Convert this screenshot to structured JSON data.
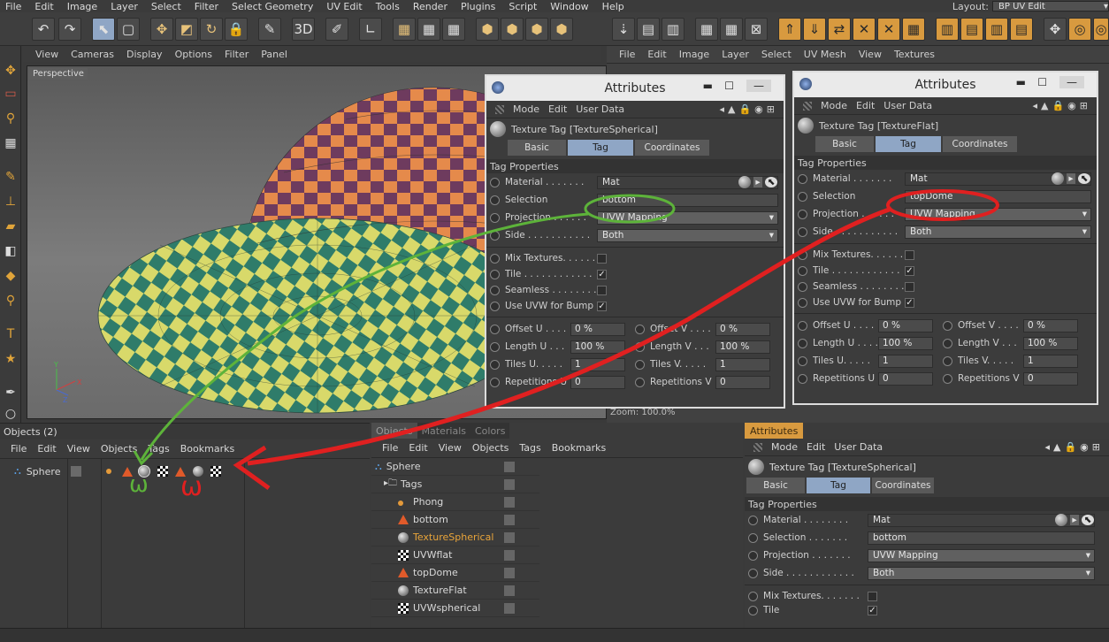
{
  "menubar": {
    "items": [
      "File",
      "Edit",
      "Image",
      "Layer",
      "Select",
      "Filter",
      "Select Geometry",
      "UV Edit",
      "Tools",
      "Render",
      "Plugins",
      "Script",
      "Window",
      "Help"
    ],
    "layout_label": "Layout:",
    "layout_value": "BP UV Edit"
  },
  "viewport": {
    "menu": [
      "View",
      "Cameras",
      "Display",
      "Options",
      "Filter",
      "Panel"
    ],
    "label": "Perspective"
  },
  "uv": {
    "menu": [
      "File",
      "Edit",
      "Image",
      "Layer",
      "Select",
      "UV Mesh",
      "View",
      "Textures"
    ],
    "zoom": "Zoom: 100.0%"
  },
  "attr_left": {
    "title": "Attributes",
    "menu": [
      "Mode",
      "Edit",
      "User Data"
    ],
    "tag_title": "Texture Tag [TextureSpherical]",
    "tabs": [
      "Basic",
      "Tag",
      "Coordinates"
    ],
    "active_tab": "Tag",
    "section": "Tag Properties",
    "material_label": "Material . . . . . . .",
    "material": "Mat",
    "selection_label": "Selection",
    "selection": "bottom",
    "projection_label": "Projection . . . . . .",
    "projection": "UVW Mapping",
    "side_label": "Side . . . . . . . . . . .",
    "side": "Both",
    "mix_label": "Mix Textures. . . . . .",
    "tile_label": "Tile . . . . . . . . . . . .",
    "seamless_label": "Seamless . . . . . . . .",
    "uvwbump_label": "Use UVW for Bump",
    "offset_u_label": "Offset U . . . .",
    "offset_u": "0 %",
    "offset_v_label": "Offset V . . . .",
    "offset_v": "0 %",
    "length_u_label": "Length U . . .",
    "length_u": "100 %",
    "length_v_label": "Length V . . .",
    "length_v": "100 %",
    "tiles_u_label": "Tiles U. . . . .",
    "tiles_u": "1",
    "tiles_v_label": "Tiles V. . . . .",
    "tiles_v": "1",
    "rep_u_label": "Repetitions U",
    "rep_u": "0",
    "rep_v_label": "Repetitions V",
    "rep_v": "0"
  },
  "attr_right": {
    "title": "Attributes",
    "menu": [
      "Mode",
      "Edit",
      "User Data"
    ],
    "tag_title": "Texture Tag [TextureFlat]",
    "tabs": [
      "Basic",
      "Tag",
      "Coordinates"
    ],
    "active_tab": "Tag",
    "section": "Tag Properties",
    "material_label": "Material . . . . . . .",
    "material": "Mat",
    "selection_label": "Selection",
    "selection": "topDome",
    "projection_label": "Projection . . . . . .",
    "projection": "UVW Mapping",
    "side_label": "Side . . . . . . . . . . .",
    "side": "Both",
    "mix_label": "Mix Textures. . . . . .",
    "tile_label": "Tile . . . . . . . . . . . .",
    "seamless_label": "Seamless . . . . . . . .",
    "uvwbump_label": "Use UVW for Bump",
    "offset_u_label": "Offset U . . . .",
    "offset_u": "0 %",
    "offset_v_label": "Offset V . . . .",
    "offset_v": "0 %",
    "length_u_label": "Length U . . . .",
    "length_u": "100 %",
    "length_v_label": "Length V . . .",
    "length_v": "100 %",
    "tiles_u_label": "Tiles U. . . . .",
    "tiles_u": "1",
    "tiles_v_label": "Tiles V. . . . .",
    "tiles_v": "1",
    "rep_u_label": "Repetitions U",
    "rep_u": "0",
    "rep_v_label": "Repetitions V",
    "rep_v": "0"
  },
  "objects": {
    "title": "Objects (2)",
    "menu": [
      "File",
      "Edit",
      "View",
      "Objects",
      "Tags",
      "Bookmarks"
    ],
    "sphere": "Sphere"
  },
  "objmgr": {
    "tabs": [
      "Objects",
      "Materials",
      "Colors"
    ],
    "menu": [
      "File",
      "Edit",
      "View",
      "Objects",
      "Tags",
      "Bookmarks"
    ],
    "rows": [
      "Sphere",
      "Tags",
      "Phong",
      "bottom",
      "TextureSpherical",
      "UVWflat",
      "topDome",
      "TextureFlat",
      "UVWspherical"
    ]
  },
  "attr_bottom": {
    "tab": "Attributes",
    "menu": [
      "Mode",
      "Edit",
      "User Data"
    ],
    "tag_title": "Texture Tag [TextureSpherical]",
    "tabs": [
      "Basic",
      "Tag",
      "Coordinates"
    ],
    "section": "Tag Properties",
    "material_label": "Material . . . . . . . .",
    "material": "Mat",
    "selection_label": "Selection . . . . . . .",
    "selection": "bottom",
    "projection_label": "Projection . . . . . . .",
    "projection": "UVW Mapping",
    "side_label": "Side . . . . . . . . . . . .",
    "side": "Both",
    "mix_label": "Mix Textures. . . . . . .",
    "tile_label": "Tile"
  },
  "annotations": {
    "green_mark": "ω",
    "red_mark": "ω"
  },
  "colors": {
    "accent": "#d89a3f",
    "tab_active": "#8fa6c5",
    "annotation_red": "#e02020",
    "annotation_green": "#5db33a"
  }
}
